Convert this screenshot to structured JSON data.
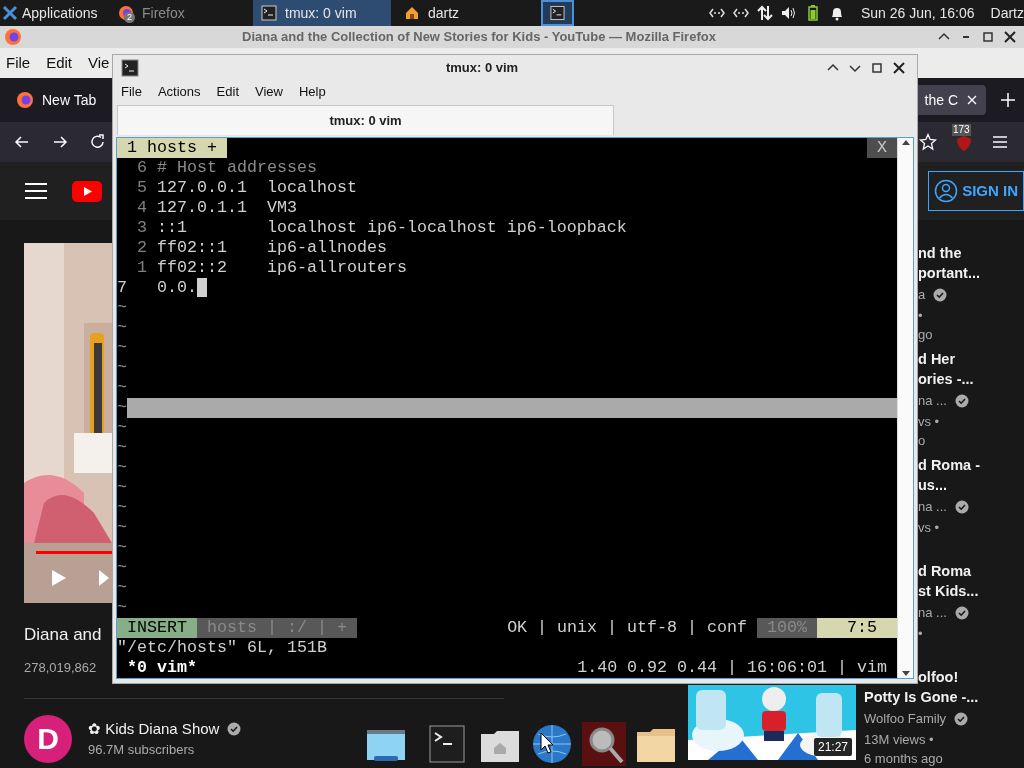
{
  "panel": {
    "menu": "Applications",
    "tasks": [
      {
        "kind": "firefox",
        "label": "Firefox",
        "badge": "2",
        "selected": false
      },
      {
        "kind": "terminal",
        "label": "tmux: 0 vim",
        "selected": true
      },
      {
        "kind": "home",
        "label": "dartz",
        "selected": false
      },
      {
        "kind": "workspace",
        "selected": true
      }
    ],
    "clock": "Sun 26 Jun, 16:06",
    "user": "Dartz"
  },
  "firefox": {
    "title": "Diana and the Collection of New Stories for Kids - YouTube — Mozilla Firefox",
    "menu": [
      "File",
      "Edit",
      "Vie"
    ],
    "tabs": [
      {
        "label": "New Tab",
        "selected": false
      },
      {
        "label": "the C",
        "selected": true
      }
    ],
    "addon_badge": "173"
  },
  "youtube": {
    "sign_in": "SIGN IN",
    "video": {
      "title": "Diana and",
      "views": "278,019,862"
    },
    "channel": {
      "avatar": "D",
      "name": "✿ Kids Diana Show",
      "subscribers": "96.7M subscribers"
    },
    "related": [
      {
        "kind": "clipped",
        "title": [
          "nd the",
          "portant..."
        ],
        "channel": "a",
        "views": "•",
        "age": "go"
      },
      {
        "kind": "clipped",
        "title": [
          "d Her",
          "ories -..."
        ],
        "channel": "na ...",
        "views": "vs •",
        "age": "o"
      },
      {
        "kind": "clipped",
        "title": [
          "d Roma -",
          "us..."
        ],
        "channel": "na ...",
        "views": "vs •"
      },
      {
        "kind": "clipped",
        "title": [
          "d Roma",
          "st Kids..."
        ],
        "channel": "na ...",
        "views": "•"
      },
      {
        "kind": "full",
        "title": [
          "olfoo!",
          "Potty Is Gone -..."
        ],
        "channel": "Wolfoo Family",
        "views": "13M views •",
        "age": "6 months ago",
        "duration": "21:27"
      }
    ]
  },
  "terminal": {
    "title": "tmux: 0 vim",
    "menu": [
      "File",
      "Actions",
      "Edit",
      "View",
      "Help"
    ],
    "tab": "tmux: 0 vim",
    "vim": {
      "tabline": {
        "label": "1 hosts +",
        "close": "X"
      },
      "lines": [
        {
          "number": "6",
          "text": "# Host addresses",
          "kind": "comment",
          "current": false
        },
        {
          "number": "5",
          "text": "127.0.0.1  localhost",
          "kind": "text",
          "current": false
        },
        {
          "number": "4",
          "text": "127.0.1.1  VM3",
          "kind": "text",
          "current": false
        },
        {
          "number": "3",
          "text": "::1        localhost ip6-localhost ip6-loopback",
          "kind": "text",
          "current": false
        },
        {
          "number": "2",
          "text": "ff02::1    ip6-allnodes",
          "kind": "text",
          "current": false
        },
        {
          "number": "1",
          "text": "ff02::2    ip6-allrouters",
          "kind": "text",
          "current": false
        },
        {
          "number": "7",
          "text": "0.0.",
          "kind": "text",
          "current": true
        }
      ],
      "filler": [
        {
          "text": "~",
          "highlighted": false
        },
        {
          "text": "~",
          "highlighted": false
        },
        {
          "text": "~",
          "highlighted": false
        },
        {
          "text": "~",
          "highlighted": false
        },
        {
          "text": "~",
          "highlighted": false
        },
        {
          "text": "~",
          "highlighted": true
        },
        {
          "text": "~",
          "highlighted": false
        },
        {
          "text": "~",
          "highlighted": false
        },
        {
          "text": "~",
          "highlighted": false
        },
        {
          "text": "~",
          "highlighted": false
        },
        {
          "text": "~",
          "highlighted": false
        },
        {
          "text": "~",
          "highlighted": false
        },
        {
          "text": "~",
          "highlighted": false
        },
        {
          "text": "~",
          "highlighted": false
        },
        {
          "text": "~",
          "highlighted": false
        },
        {
          "text": "~",
          "highlighted": false
        }
      ],
      "status": {
        "mode": "INSERT",
        "file": "hosts | :/ | +",
        "info": "OK | unix | utf-8 | conf",
        "percent": "100%",
        "position": "7:5"
      },
      "cmdline": "\"/etc/hosts\" 6L, 151B"
    },
    "tmux": {
      "window": "*0 vim*",
      "right": "1.40 0.92 0.44 | 16:06:01 | vim"
    }
  }
}
